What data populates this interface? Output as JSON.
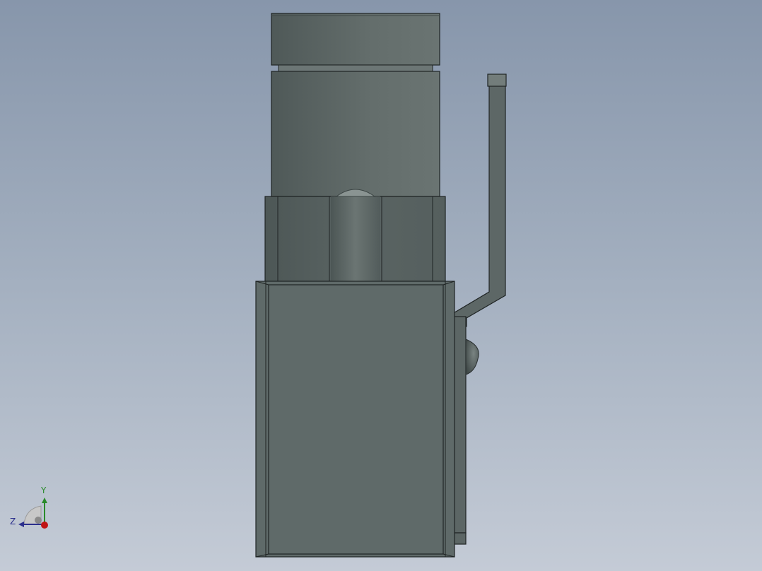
{
  "viewport": {
    "background_top": "#8796ab",
    "background_bottom": "#c4cbd6"
  },
  "model": {
    "body_color": "#5f6a69",
    "edge_color": "#1f2424"
  },
  "triad": {
    "axis_y_label": "Y",
    "axis_z_label": "Z",
    "y_color": "#2a8a2a",
    "z_color": "#2b2f8c",
    "x_color": "#c01515"
  }
}
